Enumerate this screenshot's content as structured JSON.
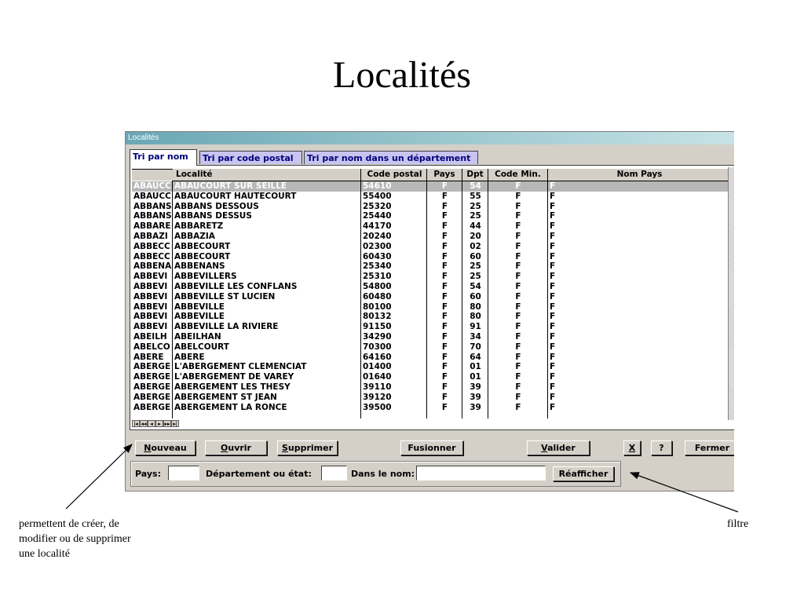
{
  "slide": {
    "title": "Localités",
    "annotation_left": [
      "permettent de créer, de",
      "modifier ou de supprimer",
      "une localité"
    ],
    "annotation_right": "filtre"
  },
  "window": {
    "title": "Localités",
    "tabs": [
      "Tri par nom",
      "Tri par code postal",
      "Tri par nom dans un département"
    ],
    "columns": [
      "",
      "Localité",
      "Code postal",
      "Pays",
      "Dpt",
      "Code Min.",
      "Nom Pays"
    ],
    "rows": [
      [
        "ABAUCC",
        "ABAUCOURT SUR SEILLE",
        "54610",
        "F",
        "54",
        "F",
        "F"
      ],
      [
        "ABAUCC",
        "ABAUCOURT HAUTECOURT",
        "55400",
        "F",
        "55",
        "F",
        "F"
      ],
      [
        "ABBANS",
        "ABBANS DESSOUS",
        "25320",
        "F",
        "25",
        "F",
        "F"
      ],
      [
        "ABBANS",
        "ABBANS DESSUS",
        "25440",
        "F",
        "25",
        "F",
        "F"
      ],
      [
        "ABBARE",
        "ABBARETZ",
        "44170",
        "F",
        "44",
        "F",
        "F"
      ],
      [
        "ABBAZI",
        "ABBAZIA",
        "20240",
        "F",
        "20",
        "F",
        "F"
      ],
      [
        "ABBECC",
        "ABBECOURT",
        "02300",
        "F",
        "02",
        "F",
        "F"
      ],
      [
        "ABBECC",
        "ABBECOURT",
        "60430",
        "F",
        "60",
        "F",
        "F"
      ],
      [
        "ABBENA",
        "ABBENANS",
        "25340",
        "F",
        "25",
        "F",
        "F"
      ],
      [
        "ABBEVI",
        "ABBEVILLERS",
        "25310",
        "F",
        "25",
        "F",
        "F"
      ],
      [
        "ABBEVI",
        "ABBEVILLE LES CONFLANS",
        "54800",
        "F",
        "54",
        "F",
        "F"
      ],
      [
        "ABBEVI",
        "ABBEVILLE ST LUCIEN",
        "60480",
        "F",
        "60",
        "F",
        "F"
      ],
      [
        "ABBEVI",
        "ABBEVILLE",
        "80100",
        "F",
        "80",
        "F",
        "F"
      ],
      [
        "ABBEVI",
        "ABBEVILLE",
        "80132",
        "F",
        "80",
        "F",
        "F"
      ],
      [
        "ABBEVI",
        "ABBEVILLE LA RIVIERE",
        "91150",
        "F",
        "91",
        "F",
        "F"
      ],
      [
        "ABEILH",
        "ABEILHAN",
        "34290",
        "F",
        "34",
        "F",
        "F"
      ],
      [
        "ABELCO",
        "ABELCOURT",
        "70300",
        "F",
        "70",
        "F",
        "F"
      ],
      [
        "ABERE",
        "ABERE",
        "64160",
        "F",
        "64",
        "F",
        "F"
      ],
      [
        "ABERGE",
        "L'ABERGEMENT CLEMENCIAT",
        "01400",
        "F",
        "01",
        "F",
        "F"
      ],
      [
        "ABERGE",
        "L'ABERGEMENT DE VAREY",
        "01640",
        "F",
        "01",
        "F",
        "F"
      ],
      [
        "ABERGE",
        "ABERGEMENT LES THESY",
        "39110",
        "F",
        "39",
        "F",
        "F"
      ],
      [
        "ABERGE",
        "ABERGEMENT ST JEAN",
        "39120",
        "F",
        "39",
        "F",
        "F"
      ],
      [
        "ABERGE",
        "ABERGEMENT LA RONCE",
        "39500",
        "F",
        "39",
        "F",
        "F"
      ]
    ],
    "buttons": {
      "nouveau": {
        "key": "N",
        "rest": "ouveau"
      },
      "ouvrir": {
        "key": "O",
        "rest": "uvrir"
      },
      "supprimer": {
        "key": "S",
        "rest": "upprimer"
      },
      "fusionner": "Fusionner",
      "valider": {
        "key": "V",
        "rest": "alider"
      },
      "close": "X",
      "help": "?",
      "fermer": "Fermer"
    },
    "filter": {
      "pays_label": "Pays:",
      "pays_value": "",
      "dept_label": "Département ou état:",
      "dept_value": "",
      "nom_label": "Dans le nom:",
      "nom_value": "",
      "refresh": "Réafficher"
    }
  },
  "colors": {
    "selected_row": "#b7b7b7",
    "tab_inactive": "#c8c4f0",
    "tab_text": "#00007a",
    "titlebar_start": "#6aa7b4"
  }
}
